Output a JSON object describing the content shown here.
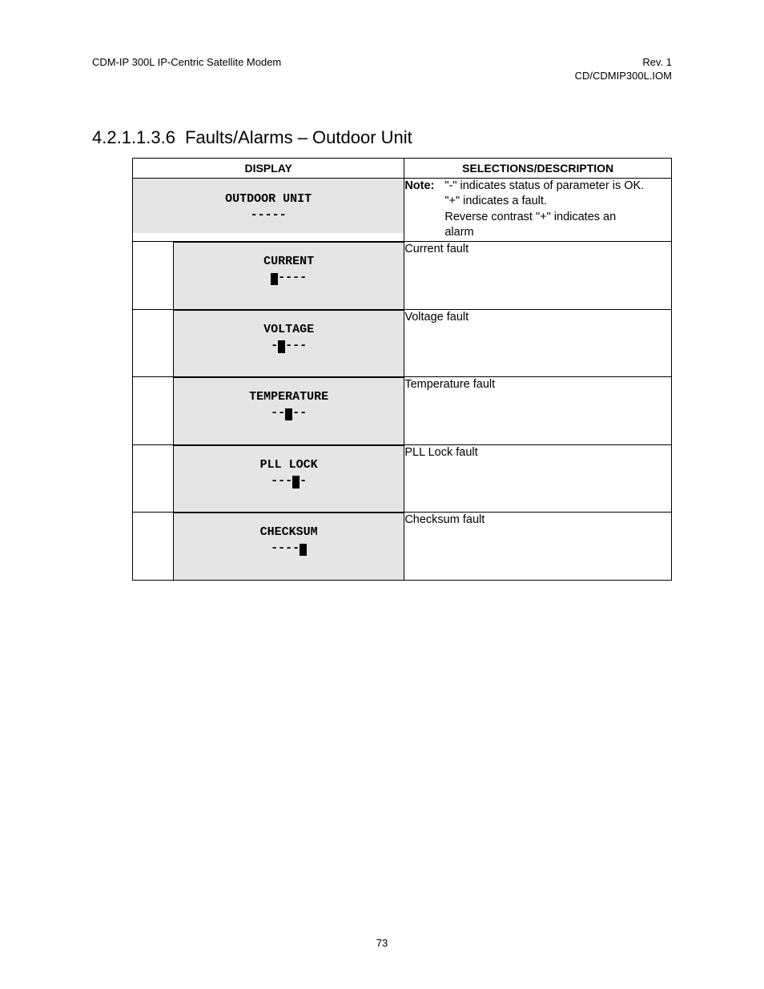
{
  "header": {
    "left": "CDM-IP 300L IP-Centric Satellite Modem",
    "right_line1": "Rev. 1",
    "right_line2": "CD/CDMIP300L.IOM"
  },
  "section": {
    "number": "4.2.1.1.3.6",
    "title": "Faults/Alarms – Outdoor Unit"
  },
  "table": {
    "col1": "DISPLAY",
    "col2": "SELECTIONS/DESCRIPTION",
    "main_display_line1": "OUTDOOR UNIT",
    "main_display_line2": "-----",
    "note_label": "Note:",
    "note_body": "\"-\" indicates status of parameter is OK. \"+\" indicates a fault.\nReverse contrast \"+\" indicates an alarm",
    "rows": [
      {
        "display_line1": "CURRENT",
        "display_pre": "",
        "display_post": "----",
        "desc": "Current fault"
      },
      {
        "display_line1": "VOLTAGE",
        "display_pre": "-",
        "display_post": "---",
        "desc": "Voltage fault"
      },
      {
        "display_line1": "TEMPERATURE",
        "display_pre": "--",
        "display_post": "--",
        "desc": "Temperature fault"
      },
      {
        "display_line1": "PLL LOCK",
        "display_pre": "---",
        "display_post": "-",
        "desc": "PLL Lock fault"
      },
      {
        "display_line1": "CHECKSUM",
        "display_pre": "----",
        "display_post": "",
        "desc": "Checksum fault"
      }
    ]
  },
  "page_number": "73"
}
